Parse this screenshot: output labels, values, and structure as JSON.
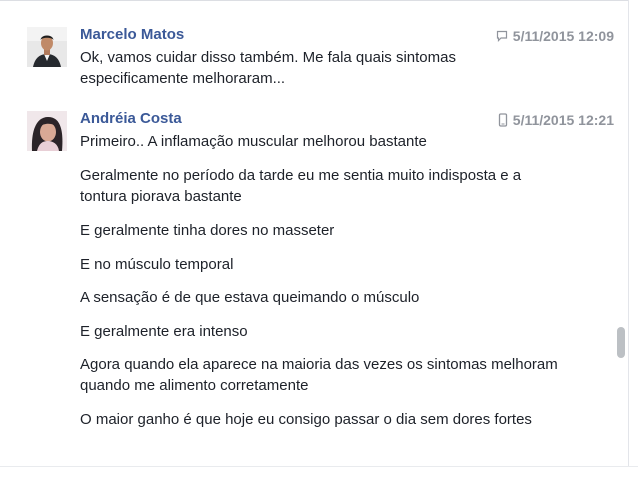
{
  "colors": {
    "name": "#3b5998",
    "text": "#1d2129",
    "meta": "#90949c"
  },
  "thread": [
    {
      "author": "Marcelo Matos",
      "timestamp": "5/11/2015 12:09",
      "source_icon": "chat-bubble-icon",
      "messages": [
        "Ok, vamos cuidar disso também. Me fala quais sintomas especificamente melhoraram..."
      ]
    },
    {
      "author": "Andréia Costa",
      "timestamp": "5/11/2015 12:21",
      "source_icon": "mobile-phone-icon",
      "messages": [
        "Primeiro.. A inflamação muscular melhorou bastante",
        "Geralmente no período da tarde eu me sentia muito indisposta e a tontura piorava bastante",
        "E geralmente tinha dores no masseter",
        "E no músculo temporal",
        "A sensação é de que estava queimando o músculo",
        "E geralmente era intenso",
        "Agora quando ela aparece na maioria das vezes os sintomas melhoram quando me alimento corretamente",
        "O maior ganho é que hoje eu consigo passar o dia sem dores fortes"
      ]
    }
  ]
}
